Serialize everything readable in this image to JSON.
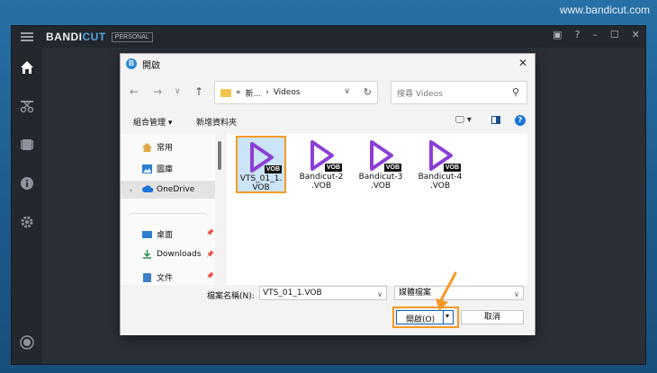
{
  "watermark": "www.bandicut.com",
  "app": {
    "brand_a": "BANDI",
    "brand_b": "CUT",
    "edition": "PERSONAL",
    "sidebar_icons": [
      "home-icon",
      "cut-icon",
      "film-icon",
      "info-icon",
      "settings-icon",
      "record-icon"
    ]
  },
  "dialog": {
    "title": "開啟",
    "close": "✕",
    "breadcrumb": {
      "prefix": "«",
      "parent": "新...",
      "sep": "›",
      "current": "Videos"
    },
    "search_placeholder": "搜尋 Videos",
    "toolbar": {
      "organize": "組合管理 ▾",
      "new_folder": "新增資料夾",
      "help": "?"
    },
    "nav": [
      {
        "label": "常用",
        "icon": "home-icon"
      },
      {
        "label": "圖庫",
        "icon": "gallery-icon"
      },
      {
        "label": "OneDrive",
        "icon": "cloud-icon"
      },
      {
        "label": "桌面",
        "icon": "desktop-icon"
      },
      {
        "label": "Downloads",
        "icon": "download-icon"
      },
      {
        "label": "文件",
        "icon": "document-icon"
      }
    ],
    "files": [
      {
        "name1": "VTS_01_1.",
        "name2": "VOB",
        "badge": "VOB",
        "selected": true
      },
      {
        "name1": "Bandicut-2",
        "name2": ".VOB",
        "badge": "VOB",
        "selected": false
      },
      {
        "name1": "Bandicut-3",
        "name2": ".VOB",
        "badge": "VOB",
        "selected": false
      },
      {
        "name1": "Bandicut-4",
        "name2": ".VOB",
        "badge": "VOB",
        "selected": false
      }
    ],
    "filename_label": "檔案名稱(N):",
    "filename_value": "VTS_01_1.VOB",
    "filetype_value": "媒體檔案",
    "open_label": "開啟(O)",
    "cancel_label": "取消"
  },
  "colors": {
    "accent": "#f59a23",
    "play_icon": "#8c3fd6",
    "brand_blue": "#4fa3e0"
  }
}
